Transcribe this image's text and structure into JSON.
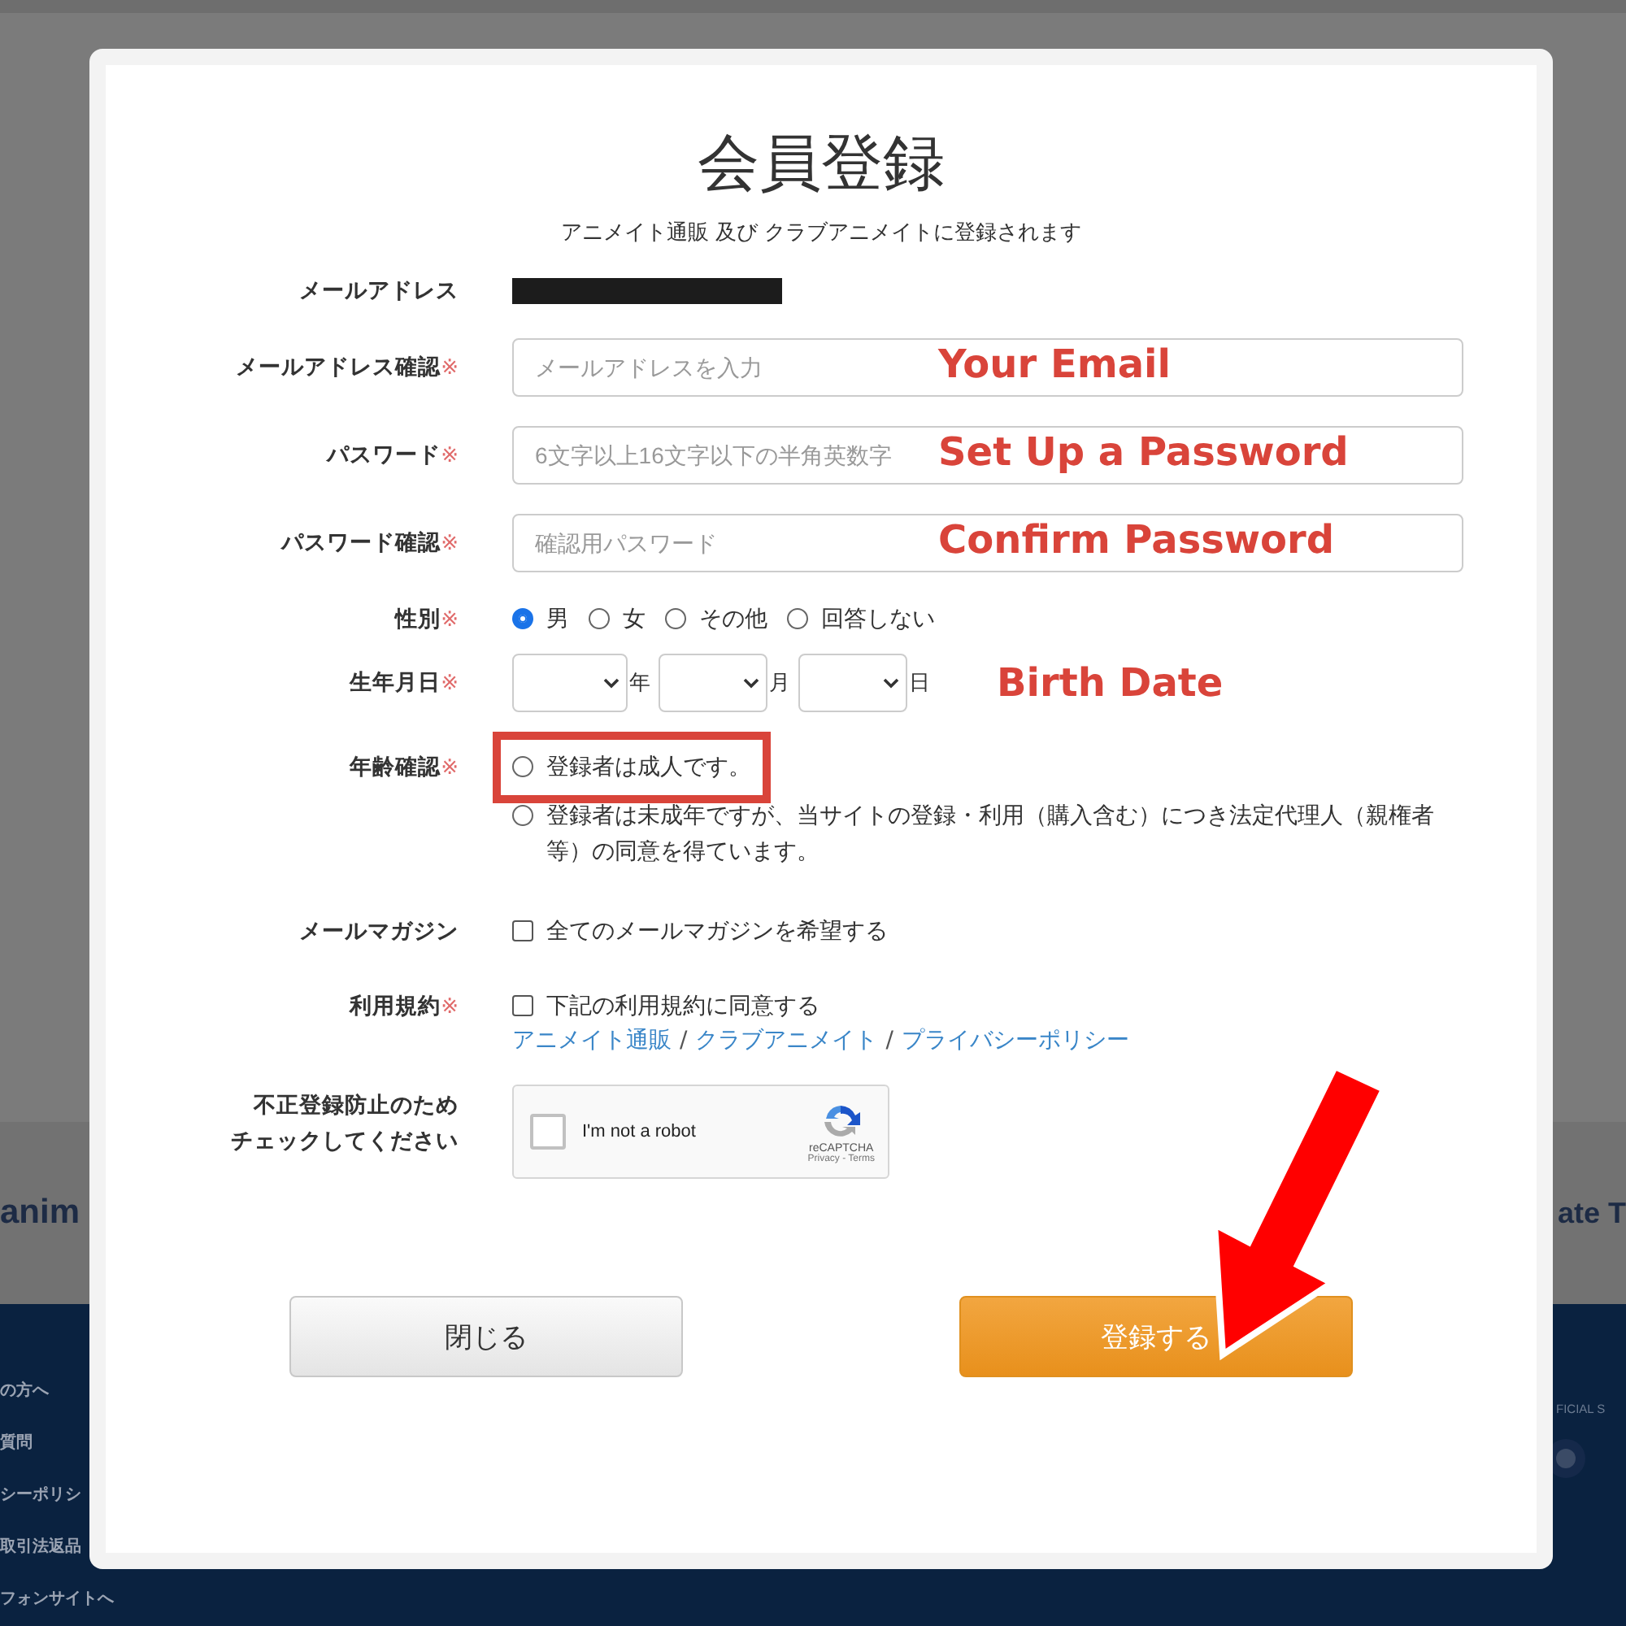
{
  "background": {
    "logo_left": "anim",
    "logo_right": "ate T",
    "footer_links": [
      "の方へ",
      "質問",
      "シーポリシ",
      "取引法返品",
      "フォンサイトへ"
    ],
    "footer_label": "FICIAL S"
  },
  "modal": {
    "title": "会員登録",
    "subtitle": "アニメイト通販 及び クラブアニメイトに登録されます",
    "rows": [
      {
        "kind": "redacted",
        "label": "メールアドレス"
      },
      {
        "kind": "input",
        "label": "メールアドレス確認",
        "required_mark": "※",
        "placeholder": "メールアドレスを入力",
        "annotation": "Your Email"
      },
      {
        "kind": "input",
        "label": "パスワード",
        "required_mark": "※",
        "placeholder": "6文字以上16文字以下の半角英数字",
        "annotation": "Set Up a Password"
      },
      {
        "kind": "input",
        "label": "パスワード確認",
        "required_mark": "※",
        "placeholder": "確認用パスワード",
        "annotation": "Confirm Password"
      },
      {
        "kind": "radio",
        "label": "性別",
        "required_mark": "※",
        "options": [
          {
            "label": "男",
            "selected": true
          },
          {
            "label": "女",
            "selected": false
          },
          {
            "label": "その他",
            "selected": false
          },
          {
            "label": "回答しない",
            "selected": false
          }
        ]
      },
      {
        "kind": "date",
        "label": "生年月日",
        "required_mark": "※",
        "units": [
          "年",
          "月",
          "日"
        ],
        "annotation": "Birth Date"
      },
      {
        "kind": "age",
        "label": "年齢確認",
        "required_mark": "※",
        "options": [
          {
            "label": "登録者は成人です。",
            "selected": false,
            "highlighted": true
          },
          {
            "label": "登録者は未成年ですが、当サイトの登録・利用（購入含む）につき法定代理人（親権者等）の同意を得ています。",
            "selected": false,
            "highlighted": false
          }
        ]
      },
      {
        "kind": "checkbox",
        "label": "メールマガジン",
        "checkbox": {
          "label": "全てのメールマガジンを希望する",
          "checked": false
        }
      },
      {
        "kind": "terms",
        "label": "利用規約",
        "required_mark": "※",
        "checkbox": {
          "label": "下記の利用規約に同意する",
          "checked": false
        },
        "links": [
          "アニメイト通販",
          "クラブアニメイト",
          "プライバシーポリシー"
        ],
        "separator": "/"
      },
      {
        "kind": "captcha",
        "label_lines": [
          "不正登録防止のため",
          "チェックしてください"
        ],
        "captcha": {
          "label": "I'm not a robot",
          "brand": "reCAPTCHA",
          "links": "Privacy - Terms",
          "checked": false
        }
      }
    ],
    "buttons": [
      {
        "label": "閉じる",
        "kind": "secondary"
      },
      {
        "label": "登録する",
        "kind": "primary"
      }
    ]
  },
  "arrow": {
    "kind": "pointer"
  }
}
